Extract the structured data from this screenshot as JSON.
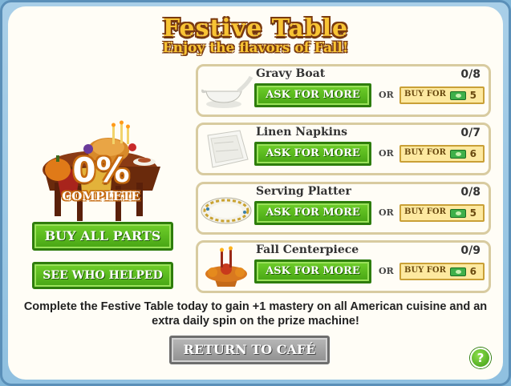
{
  "header": {
    "title": "Festive Table",
    "subtitle": "Enjoy the flavors of Fall!"
  },
  "progress": {
    "percent_label": "0%",
    "complete_label": "COMPLETE",
    "percent": 0
  },
  "left_buttons": {
    "buy_all": "BUY ALL PARTS",
    "see_who": "SEE WHO HELPED"
  },
  "parts": [
    {
      "name": "Gravy Boat",
      "count": "0/8",
      "ask_label": "ASK FOR MORE",
      "or_label": "OR",
      "buy_label": "BUY FOR",
      "price": "5",
      "icon": "gravy-boat-icon"
    },
    {
      "name": "Linen Napkins",
      "count": "0/7",
      "ask_label": "ASK FOR MORE",
      "or_label": "OR",
      "buy_label": "BUY FOR",
      "price": "6",
      "icon": "linen-napkins-icon"
    },
    {
      "name": "Serving Platter",
      "count": "0/8",
      "ask_label": "ASK FOR MORE",
      "or_label": "OR",
      "buy_label": "BUY FOR",
      "price": "5",
      "icon": "serving-platter-icon"
    },
    {
      "name": "Fall Centerpiece",
      "count": "0/9",
      "ask_label": "ASK FOR MORE",
      "or_label": "OR",
      "buy_label": "BUY FOR",
      "price": "6",
      "icon": "fall-centerpiece-icon"
    }
  ],
  "description": "Complete the Festive Table today to gain +1 mastery on all American cuisine and an extra daily spin on the prize machine!",
  "footer": {
    "return_label": "RETURN TO CAFÉ",
    "help_label": "?"
  },
  "colors": {
    "title_gold": "#f8c434",
    "button_green": "#47a514",
    "frame_blue": "#8fc0e0",
    "return_gray": "#909090"
  }
}
